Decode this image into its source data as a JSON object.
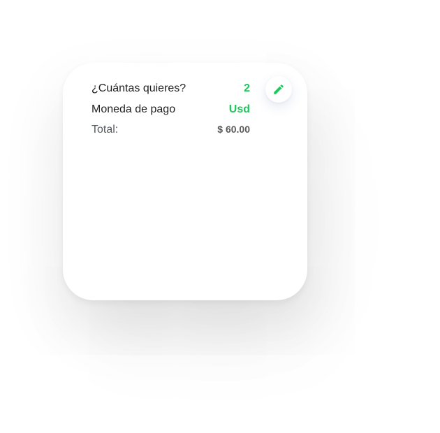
{
  "summary": {
    "quantity": {
      "label": "¿Cuántas quieres?",
      "value": "2"
    },
    "currency": {
      "label": "Moneda de pago",
      "value": "Usd"
    },
    "total": {
      "label": "Total:",
      "value": "$ 60.00"
    }
  },
  "edit_button": {
    "icon": "pencil-icon"
  },
  "colors": {
    "accent": "#22c55e",
    "text": "#1f1f1f",
    "muted": "#5a5a5a"
  }
}
